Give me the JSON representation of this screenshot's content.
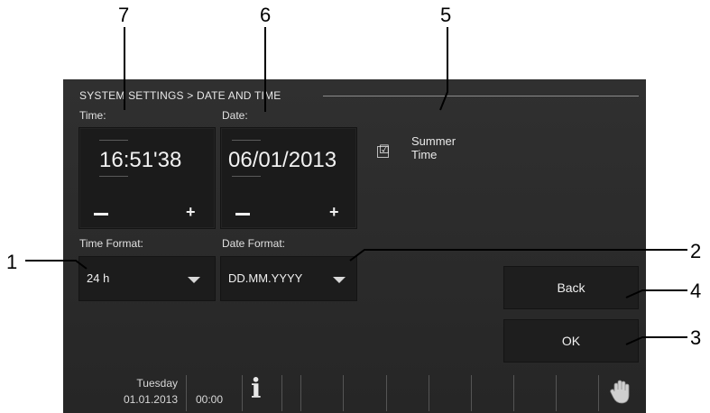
{
  "callouts": [
    "7",
    "6",
    "5",
    "1",
    "2",
    "4",
    "3"
  ],
  "breadcrumb": "SYSTEM SETTINGS > DATE AND TIME",
  "time": {
    "label": "Time:",
    "value": "16:51'38",
    "minus_icon": "minus-icon",
    "plus_label": "+"
  },
  "date": {
    "label": "Date:",
    "value": "06/01/2013",
    "minus_icon": "minus-icon",
    "plus_label": "+"
  },
  "summer_time": {
    "label": "Summer\nTime",
    "checked": true,
    "check_glyph": "☑"
  },
  "time_format": {
    "label": "Time Format:",
    "value": "24 h"
  },
  "date_format": {
    "label": "Date Format:",
    "value": "DD.MM.YYYY"
  },
  "buttons": {
    "back": "Back",
    "ok": "OK"
  },
  "status": {
    "day": "Tuesday",
    "date": "01.01.2013",
    "clock": "00:00",
    "info_glyph": "i",
    "hand_icon": "hand-icon"
  },
  "colors": {
    "screen": "#2b2b2b",
    "tile": "#1b1b1b",
    "text": "#f0f0f0"
  }
}
